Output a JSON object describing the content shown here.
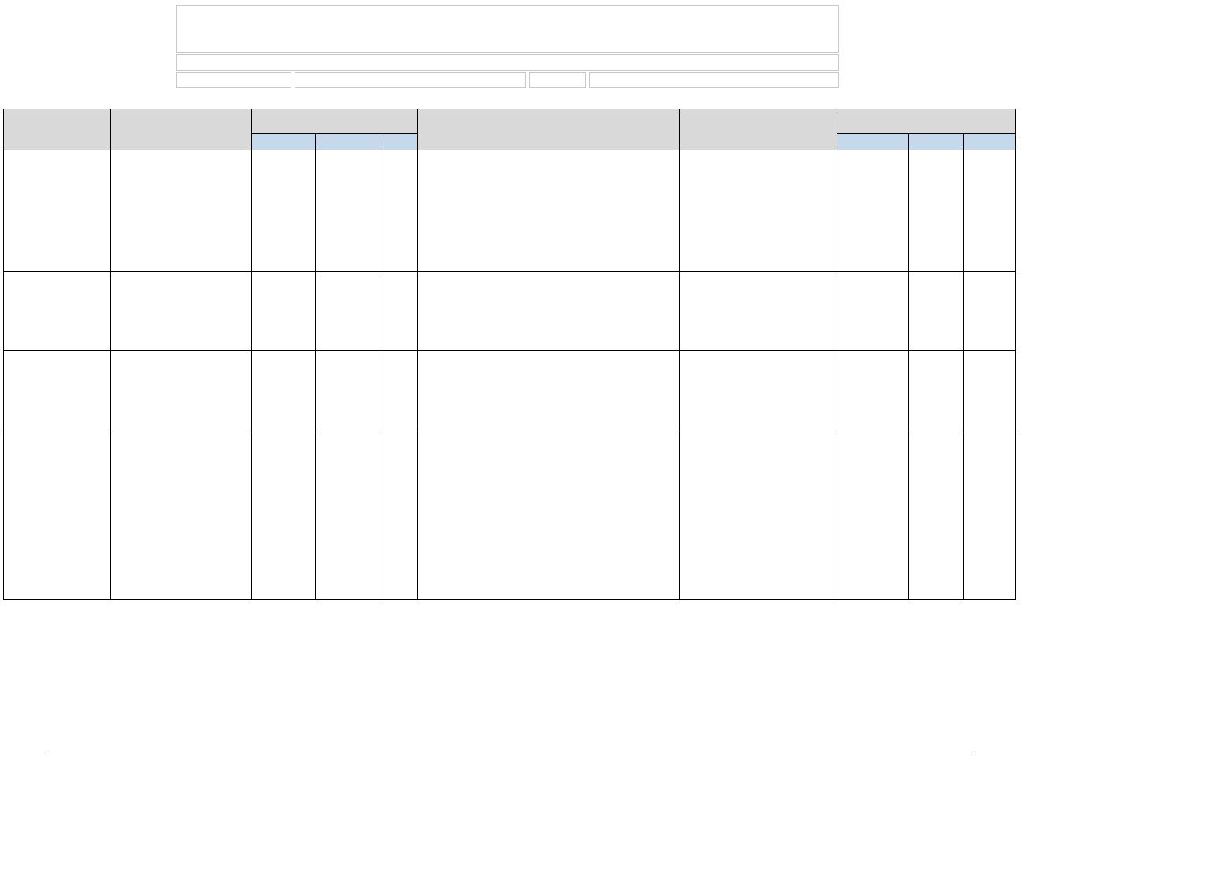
{
  "header": {
    "box1": "",
    "box2": "",
    "row3": {
      "c1": "",
      "c2": "",
      "c3": "",
      "c4": ""
    }
  },
  "table": {
    "top_headers": {
      "a": "",
      "b": "",
      "c_group": "",
      "d": "",
      "e": "",
      "f_group": ""
    },
    "sub_headers": {
      "c1": "",
      "c2": "",
      "c3": "",
      "f1": "",
      "f2": "",
      "f3": ""
    },
    "rows": [
      {
        "a": "",
        "b": "",
        "c1": "",
        "c2": "",
        "c3": "",
        "d": "",
        "e": "",
        "f1": "",
        "f2": "",
        "f3": ""
      },
      {
        "a": "",
        "b": "",
        "c1": "",
        "c2": "",
        "c3": "",
        "d": "",
        "e": "",
        "f1": "",
        "f2": "",
        "f3": ""
      },
      {
        "a": "",
        "b": "",
        "c1": "",
        "c2": "",
        "c3": "",
        "d": "",
        "e": "",
        "f1": "",
        "f2": "",
        "f3": ""
      },
      {
        "a": "",
        "b": "",
        "c1": "",
        "c2": "",
        "c3": "",
        "d": "",
        "e": "",
        "f1": "",
        "f2": "",
        "f3": ""
      }
    ]
  }
}
